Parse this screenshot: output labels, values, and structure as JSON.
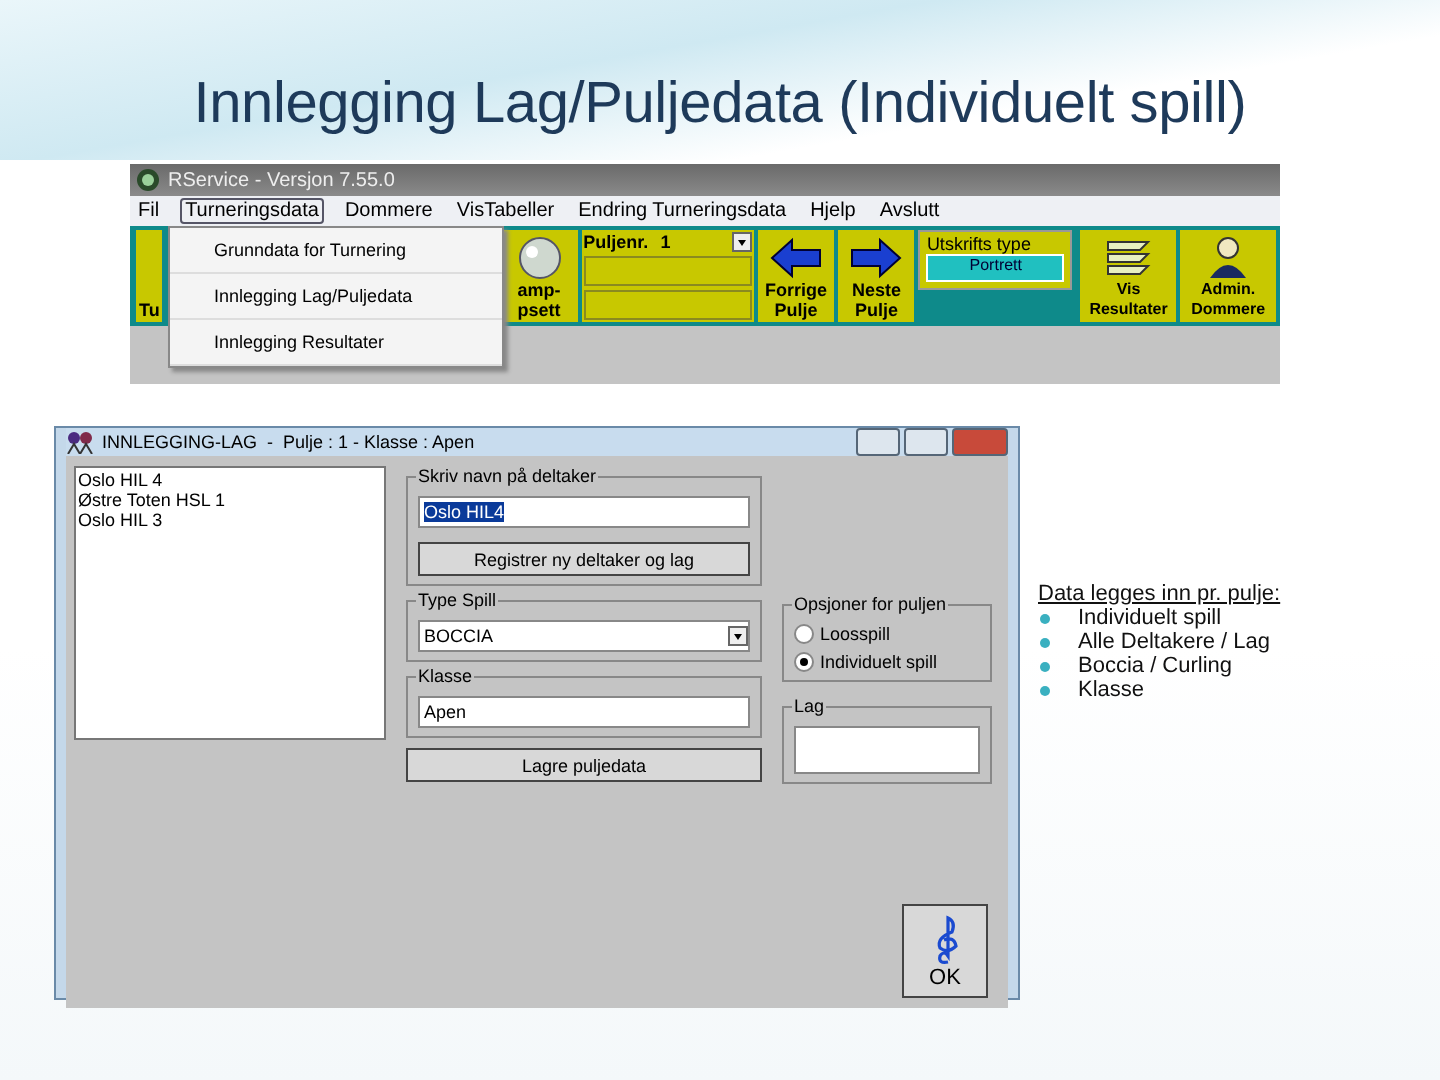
{
  "slide_title": "Innlegging Lag/Puljedata (Individuelt spill)",
  "app_window": {
    "title": "RService - Versjon 7.55.0",
    "menu": [
      {
        "label": "Fil",
        "selected": false
      },
      {
        "label": "Turneringsdata",
        "selected": true
      },
      {
        "label": "Dommere",
        "selected": false
      },
      {
        "label": "VisTabeller",
        "selected": false
      },
      {
        "label": "Endring Turneringsdata",
        "selected": false
      },
      {
        "label": "Hjelp",
        "selected": false
      },
      {
        "label": "Avslutt",
        "selected": false
      }
    ],
    "dropdown": [
      "Grunndata for Turnering",
      "Innlegging Lag/Puljedata",
      "Innlegging Resultater"
    ],
    "toolbar": [
      {
        "kind": "plain",
        "lines": [
          "Tu"
        ]
      },
      {
        "kind": "gap"
      },
      {
        "kind": "ball",
        "lines": [
          "amp-",
          "psett"
        ]
      },
      {
        "kind": "pulje",
        "label": "Puljenr.",
        "value": "1"
      },
      {
        "kind": "previous",
        "lines": [
          "Forrige",
          "Pulje"
        ]
      },
      {
        "kind": "next",
        "lines": [
          "Neste",
          "Pulje"
        ]
      },
      {
        "kind": "print",
        "label": "Utskrifts type",
        "value": "Portrett"
      },
      {
        "kind": "gap"
      },
      {
        "kind": "results",
        "lines": [
          "Vis",
          "Resultater"
        ]
      },
      {
        "kind": "admin",
        "lines": [
          "Admin.",
          "Dommere"
        ]
      }
    ]
  },
  "dialog": {
    "title": "INNLEGGING-LAG  -  Pulje : 1 - Klasse : Apen",
    "list": [
      "Oslo HIL 4",
      "Østre Toten HSL 1",
      "Oslo HIL 3"
    ],
    "name_group": {
      "label": "Skriv navn på deltaker",
      "value": "Oslo HIL4",
      "button": "Registrer ny deltaker og lag"
    },
    "type_group": {
      "label": "Type Spill",
      "value": "BOCCIA"
    },
    "class_group": {
      "label": "Klasse",
      "value": "Apen"
    },
    "save_button": "Lagre puljedata",
    "options": {
      "label": "Opsjoner for puljen",
      "items": [
        {
          "label": "Loosspill",
          "selected": false
        },
        {
          "label": "Individuelt spill",
          "selected": true
        }
      ]
    },
    "team_group": {
      "label": "Lag"
    },
    "ok_button": "OK"
  },
  "notes": {
    "heading": "Data legges inn pr. pulje:",
    "bullets": [
      "Individuelt spill",
      "Alle Deltakere / Lag",
      "Boccia / Curling",
      "Klasse"
    ]
  }
}
